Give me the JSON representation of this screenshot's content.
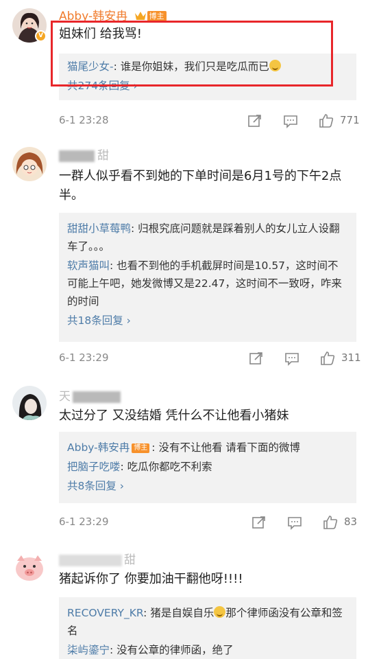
{
  "comments": [
    {
      "username": "Abby-韩安冉",
      "badge": "博主",
      "text": "姐妹们 给我骂!",
      "replies": [
        {
          "name": "猫尾少女-",
          "text": "谁是你姐妹，我们只是吃瓜而已"
        }
      ],
      "more": "共274条回复 ›",
      "time": "6-1 23:28",
      "likes": "771"
    },
    {
      "username_visible": "甜",
      "text": "一群人似乎看不到她的下单时间是6月1号的下午2点半。",
      "replies": [
        {
          "name": "甜甜小草莓鸭",
          "text": "归根究底问题就是踩着别人的女儿立人设翻车了。。。"
        },
        {
          "name": "软声猫叫",
          "text": "也看不到他的手机截屏时间是10.57，这时间不可能上午吧，她发微博又是22.47，这时间不一致呀，咋来的时间"
        }
      ],
      "more": "共18条回复 ›",
      "time": "6-1 23:29",
      "likes": "311"
    },
    {
      "username_visible": "天",
      "text": "太过分了 又没结婚 凭什么不让他看小猪妹",
      "replies": [
        {
          "name": "Abby-韩安冉",
          "tag": "博主",
          "text": "没有不让他看 请看下面的微博"
        },
        {
          "name": "把脑子吃喽",
          "text": "吃瓜你都吃不利索"
        }
      ],
      "more": "共8条回复 ›",
      "time": "6-1 23:29",
      "likes": "83"
    },
    {
      "username_visible": "甜",
      "text": "猪起诉你了 你要加油干翻他呀!!!!",
      "replies": [
        {
          "name": "RECOVERY_KR",
          "text": "猪是自娱自乐",
          "text2": "那个律师函没有公章和签名"
        },
        {
          "name": "柒屿鎏宁",
          "text": "没有公章的律师函，绝了"
        }
      ]
    }
  ],
  "icons": [
    "repost-icon",
    "comment-icon",
    "like-icon"
  ],
  "colors": {
    "accent_blue": "#4e7ca8",
    "username_orange": "#f07b2c",
    "highlight_red": "#e8262a"
  }
}
